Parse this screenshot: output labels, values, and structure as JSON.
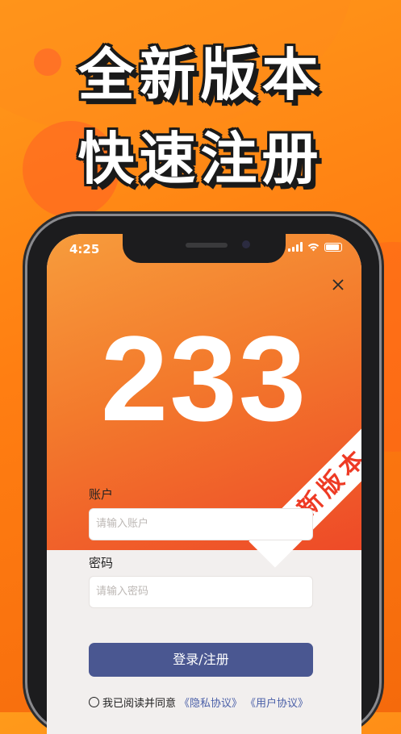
{
  "promo": {
    "line1": "全新版本",
    "line2": "快速注册"
  },
  "status_bar": {
    "time": "4:25"
  },
  "app": {
    "logo_number": "233",
    "ribbon_text": "新版本",
    "close_icon": "close-icon",
    "account": {
      "label": "账户",
      "placeholder": "请输入账户",
      "value": ""
    },
    "password": {
      "label": "密码",
      "placeholder": "请输入密码",
      "value": ""
    },
    "submit_label": "登录/注册",
    "agreement": {
      "prefix": "我已阅读并同意",
      "privacy_link": "《隐私协议》",
      "user_link": "《用户协议》"
    }
  },
  "colors": {
    "background": "#ff8a14",
    "accent_button": "#4a5791",
    "link": "#4a5fa8",
    "ribbon_text": "#ee3a24"
  }
}
